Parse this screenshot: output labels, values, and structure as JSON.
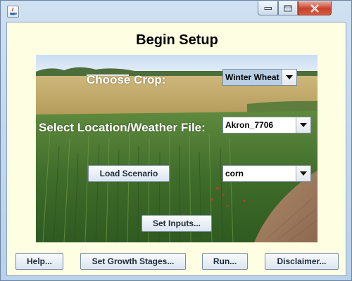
{
  "window": {
    "title": ""
  },
  "heading": "Begin Setup",
  "crop": {
    "label": "Choose Crop:",
    "selected": "Winter Wheat"
  },
  "location": {
    "label": "Select Location/Weather File:",
    "selected": "Akron_7706"
  },
  "scenario": {
    "button": "Load Scenario",
    "selected": "corn"
  },
  "inputs": {
    "button": "Set Inputs..."
  },
  "footer": {
    "help": "Help...",
    "growth": "Set Growth Stages...",
    "run": "Run...",
    "disclaimer": "Disclaimer..."
  },
  "icons": {
    "app": "java-icon",
    "minimize": "minimize-icon",
    "maximize": "maximize-icon",
    "close": "close-icon",
    "dropdown": "chevron-down-icon"
  },
  "colors": {
    "client_bg": "#fefee2",
    "combo_selected_bg": "#b8cfe5",
    "close_button": "#c8412c"
  }
}
